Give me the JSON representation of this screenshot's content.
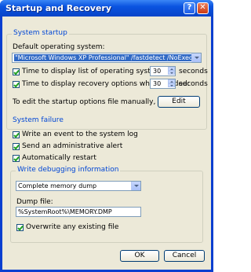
{
  "window": {
    "title": "Startup and Recovery",
    "help_label": "?",
    "close_label": "✕"
  },
  "system_startup": {
    "group_label": "System startup",
    "default_os_label": "Default operating system:",
    "default_os_value": "\"Microsoft Windows XP Professional\" /fastdetect /NoExecute=Op",
    "display_os_list_label": "Time to display list of operating systems:",
    "display_os_list_seconds": "30",
    "display_recovery_label": "Time to display recovery options when needed:",
    "display_recovery_seconds": "30",
    "seconds_label": "seconds",
    "edit_hint": "To edit the startup options file manually, click Edit.",
    "edit_button": "Edit"
  },
  "system_failure": {
    "group_label": "System failure",
    "write_event_label": "Write an event to the system log",
    "send_alert_label": "Send an administrative alert",
    "auto_restart_label": "Automatically restart",
    "debug_group_label": "Write debugging information",
    "dump_type_value": "Complete memory dump",
    "dump_file_label": "Dump file:",
    "dump_file_value": "%SystemRoot%\\MEMORY.DMP",
    "overwrite_label": "Overwrite any existing file"
  },
  "footer": {
    "ok_label": "OK",
    "cancel_label": "Cancel"
  }
}
